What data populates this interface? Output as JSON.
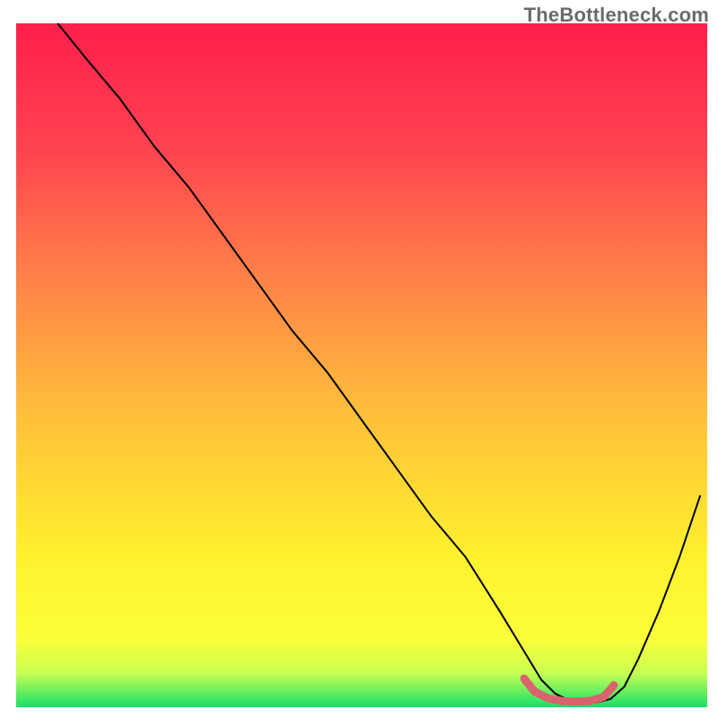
{
  "watermark": {
    "text": "TheBottleneck.com"
  },
  "chart_data": {
    "type": "line",
    "title": "",
    "xlabel": "",
    "ylabel": "",
    "xlim": [
      0,
      100
    ],
    "ylim": [
      0,
      100
    ],
    "grid": false,
    "legend": false,
    "annotations": [],
    "gradient_bands": {
      "comment": "vertical gradient background from red (top) to green (bottom)",
      "stops": [
        {
          "y_pct": 0,
          "color": "#ff1f4b"
        },
        {
          "y_pct": 18,
          "color": "#ff4250"
        },
        {
          "y_pct": 38,
          "color": "#ff8448"
        },
        {
          "y_pct": 58,
          "color": "#ffc23a"
        },
        {
          "y_pct": 78,
          "color": "#fff12e"
        },
        {
          "y_pct": 90,
          "color": "#fbff3a"
        },
        {
          "y_pct": 95,
          "color": "#c8ff52"
        },
        {
          "y_pct": 100,
          "color": "#18e06a"
        }
      ]
    },
    "series": [
      {
        "name": "bottleneck-curve",
        "color": "#000000",
        "stroke_width": 2,
        "comment": "y is the curve height as percent of plot area; minimum (~0) around x≈77-85",
        "x": [
          6,
          10,
          15,
          20,
          25,
          30,
          35,
          40,
          45,
          50,
          55,
          60,
          65,
          70,
          73,
          76,
          78,
          80,
          82,
          84,
          86,
          88,
          90,
          93,
          96,
          99
        ],
        "y": [
          100,
          95,
          89,
          82,
          76,
          69,
          62,
          55,
          49,
          42,
          35,
          28,
          22,
          14,
          9,
          4,
          2,
          1,
          0.7,
          0.7,
          1.2,
          3,
          7,
          14,
          22,
          31
        ]
      },
      {
        "name": "valley-marker",
        "color": "#d9626c",
        "stroke_width": 9,
        "linecap": "round",
        "comment": "thick salmon highlight over the flat valley",
        "x": [
          73.5,
          75,
          77,
          79,
          81,
          83,
          85,
          86.5
        ],
        "y": [
          4.2,
          2.3,
          1.3,
          0.9,
          0.8,
          0.9,
          1.5,
          3.2
        ]
      }
    ]
  }
}
